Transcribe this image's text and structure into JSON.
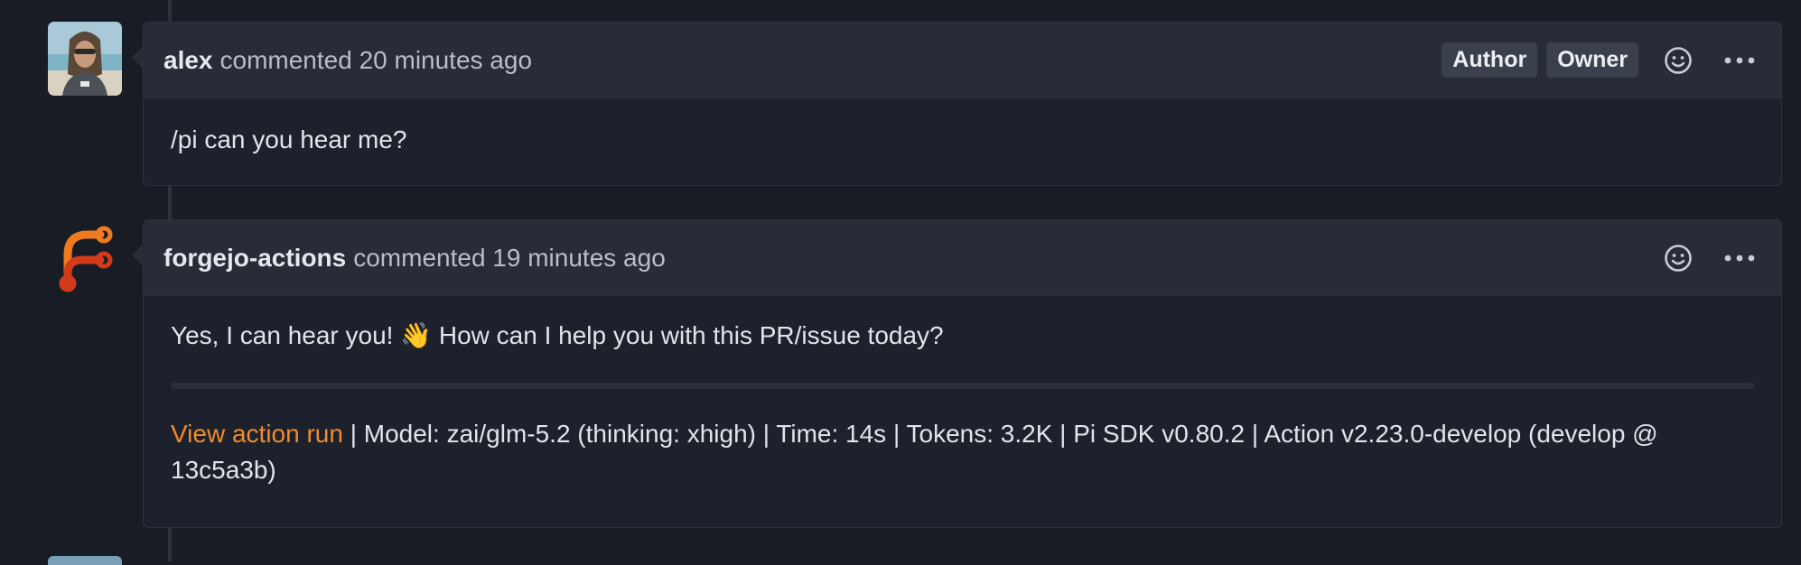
{
  "comments": [
    {
      "author": "alex",
      "meta": "commented 20 minutes ago",
      "badges": [
        "Author",
        "Owner"
      ],
      "body": "/pi can you hear me?"
    },
    {
      "author": "forgejo-actions",
      "meta": "commented 19 minutes ago",
      "body": "Yes, I can hear you! 👋 How can I help you with this PR/issue today?",
      "footer_link": "View action run",
      "footer_text_line1": " | Model: zai/glm-5.2 (thinking: xhigh) | Time: 14s | Tokens: 3.2K | Pi SDK v0.80.2 | Action v2.23.0-develop (develop @",
      "footer_text_line2": "13c5a3b)"
    }
  ],
  "icons": {
    "reaction": "smiley-icon",
    "more": "kebab-horizontal-icon",
    "forgejo": "forgejo-logo-icon"
  },
  "colors": {
    "link": "#f28a2e",
    "background": "#181c25"
  }
}
